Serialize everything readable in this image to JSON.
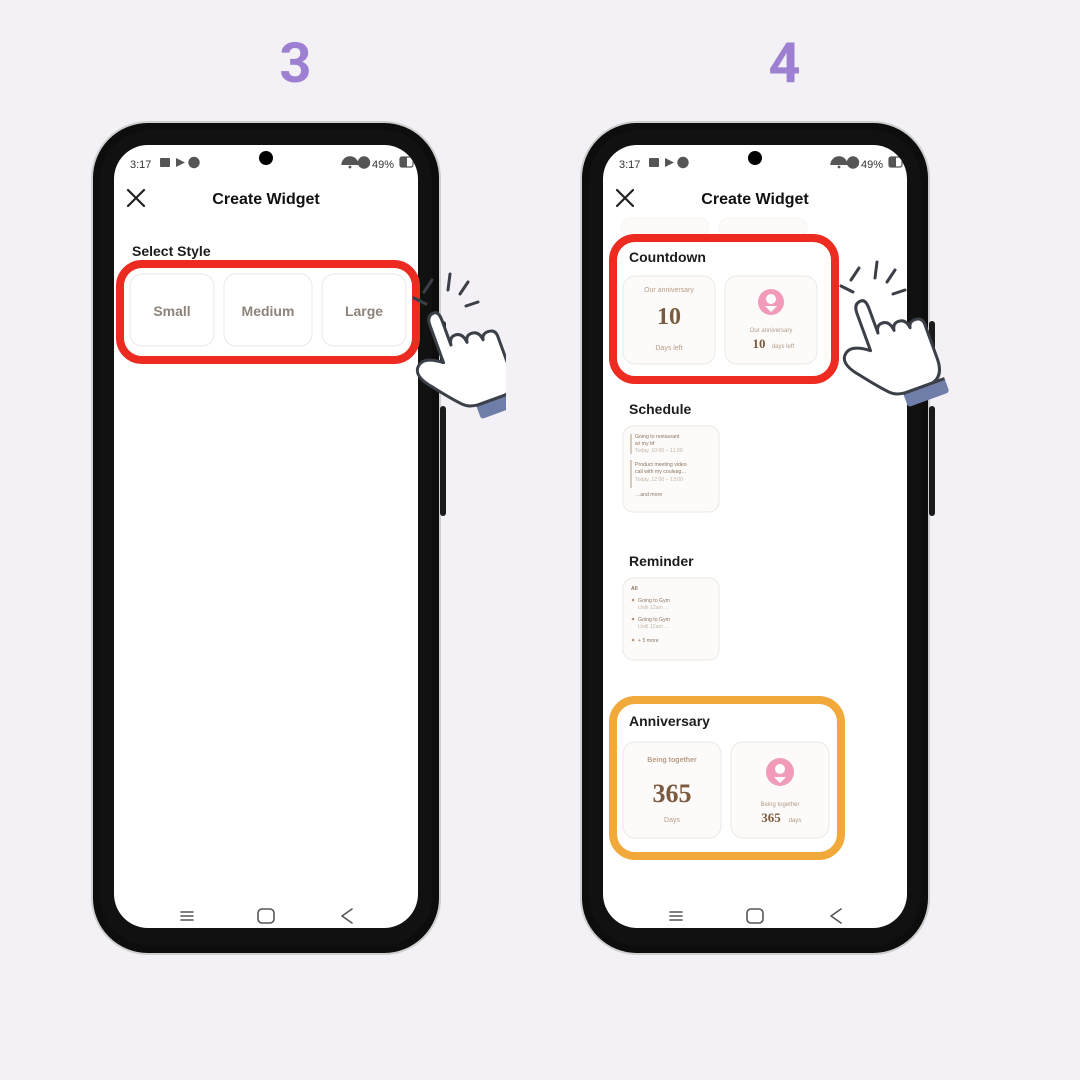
{
  "steps": {
    "left": "3",
    "right": "4"
  },
  "statusbar": {
    "time": "3:17",
    "battery": "49%"
  },
  "header": {
    "title": "Create Widget"
  },
  "left": {
    "section": "Select Style",
    "sizes": [
      "Small",
      "Medium",
      "Large"
    ]
  },
  "right": {
    "sections": {
      "countdown": "Countdown",
      "schedule": "Schedule",
      "reminder": "Reminder",
      "anniversary": "Anniversary"
    },
    "countdown": {
      "title": "Our anniversary",
      "bigNumber": "10",
      "daysLeft": "Days left",
      "alt_title": "Our anniversary",
      "alt_num": "10",
      "alt_unit": "days left"
    },
    "schedule": {
      "line1a": "Going to restaurant",
      "line1b": "w/ my bf",
      "time1": "Today, 10:00 – 11:00",
      "line2a": "Product meeting video",
      "line2b": "call with my couleag…",
      "time2": "Today, 12:00 – 13:00",
      "more": "…and more"
    },
    "reminder": {
      "title": "All",
      "rowA1": "Going to Gym",
      "rowA2": "Until 12am …",
      "rowB1": "Going to Gym",
      "rowB2": "Until 12am …",
      "more": "+ 5 more"
    },
    "anniversary": {
      "title": "Being together",
      "bigNumber": "365",
      "days": "Days",
      "alt_title": "Being together",
      "alt_num": "365",
      "alt_unit": "days"
    }
  }
}
